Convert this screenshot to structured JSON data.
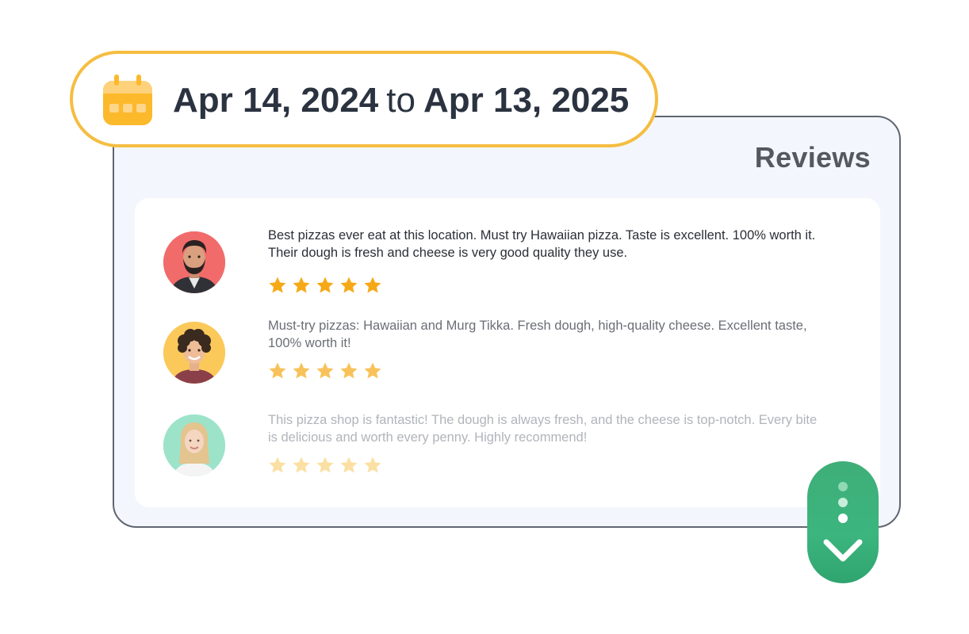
{
  "date_range": {
    "start": "Apr 14, 2024",
    "separator": "to",
    "end": "Apr 13, 2025",
    "icon": "calendar-icon",
    "accent_color": "#f5bd41"
  },
  "reviews_panel": {
    "title": "Reviews",
    "items": [
      {
        "text_line1": "Best pizzas ever eat at this location. Must try Hawaiian pizza. Taste is excellent. 100% worth it.",
        "text_line2": "Their dough is fresh and cheese is very good quality they use.",
        "rating": 5,
        "avatar_bg": "#f26b6b",
        "text_color": "#2b2f36",
        "star_color": "#f6a917"
      },
      {
        "text_line1": "Must-try pizzas: Hawaiian and Murg Tikka. Fresh dough, high-quality cheese. Excellent taste,",
        "text_line2": "100% worth it!",
        "rating": 5,
        "avatar_bg": "#fbc95a",
        "text_color": "#6a6e75",
        "star_color": "#f8c25a"
      },
      {
        "text_line1": "This pizza shop is fantastic! The dough is always fresh, and the cheese is top-notch. Every bite",
        "text_line2": "is delicious and worth every penny. Highly recommend!",
        "rating": 5,
        "avatar_bg": "#9de3c9",
        "text_color": "#b1b4ba",
        "star_color": "#fbe0a4"
      }
    ]
  },
  "scroll_button": {
    "icon": "chevron-down-icon",
    "dots_icon": "vertical-dots-icon",
    "color": "#3cb57e"
  }
}
